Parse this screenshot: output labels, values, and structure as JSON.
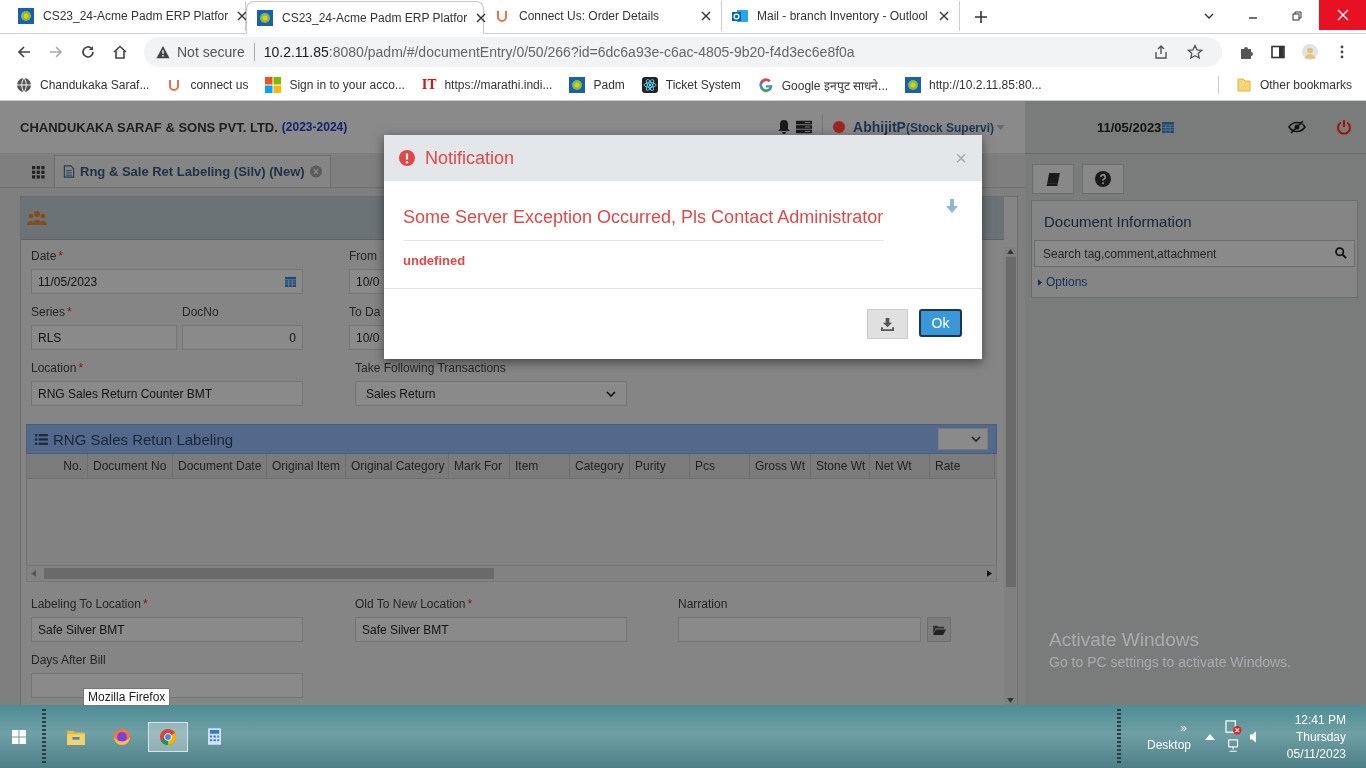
{
  "browser": {
    "tabs": [
      {
        "title": "CS23_24-Acme Padm ERP Platfor",
        "selected": false,
        "kind": "erp"
      },
      {
        "title": "CS23_24-Acme Padm ERP Platfor",
        "selected": true,
        "kind": "erp"
      },
      {
        "title": "Connect Us: Order Details",
        "selected": false,
        "kind": "connect"
      },
      {
        "title": "Mail - branch Inventory - Outlool",
        "selected": false,
        "kind": "mail"
      }
    ],
    "security": "Not secure",
    "url_host": "10.2.11.85",
    "url_path": ":8080/padm/#/documentEntry/0/50/266?id=6dc6a93e-c6ac-4805-9b20-f4d3ec6e8f0a",
    "bookmarks": [
      {
        "label": "Chandukaka Saraf...",
        "kind": "globe"
      },
      {
        "label": "connect us",
        "kind": "connect"
      },
      {
        "label": "Sign in to your acco...",
        "kind": "windows"
      },
      {
        "label": "https://marathi.indi...",
        "kind": "text",
        "logo": "IT"
      },
      {
        "label": "Padm",
        "kind": "erp"
      },
      {
        "label": "Ticket System",
        "kind": "react"
      },
      {
        "label": "Google इनपुट साधने...",
        "kind": "google"
      },
      {
        "label": "http://10.2.11.85:80...",
        "kind": "erp"
      }
    ],
    "other_bookmarks": "Other bookmarks"
  },
  "app": {
    "company": "CHANDUKAKA SARAF & SONS PVT. LTD.",
    "year": "(2023-2024)",
    "user": "AbhijitP",
    "role": "(Stock Supervi)",
    "date": "11/05/2023",
    "doc_tab": "Rng & Sale Ret Labeling (Silv) (New)"
  },
  "form": {
    "required_mark": "*",
    "date": {
      "label": "Date",
      "required": true,
      "value": "11/05/2023"
    },
    "from_date": {
      "label": "From",
      "value": "10/0"
    },
    "series": {
      "label": "Series",
      "required": true,
      "value": "RLS"
    },
    "doc_no": {
      "label": "DocNo",
      "required": false,
      "value": "0"
    },
    "to_date": {
      "label": "To Da",
      "value": "10/0"
    },
    "location": {
      "label": "Location",
      "required": true,
      "value": "RNG Sales Return Counter BMT"
    },
    "transactions": {
      "label": "Take Following Transactions",
      "required": false,
      "value": "Sales Return"
    },
    "labeling_to": {
      "label": "Labeling To Location",
      "required": true,
      "value": "Safe Silver BMT"
    },
    "old_to_new": {
      "label": "Old To New Location",
      "required": true,
      "value": "Safe Silver BMT"
    },
    "narration": {
      "label": "Narration",
      "required": false
    },
    "days_after_bill": {
      "label": "Days After Bill",
      "required": false
    }
  },
  "grid": {
    "title": "RNG Sales Retun Labeling",
    "columns": [
      "No.",
      "Document No",
      "Document Date",
      "Original Item",
      "Original Category",
      "Mark For",
      "Item",
      "Category",
      "Purity",
      "Pcs",
      "Gross Wt",
      "Stone Wt",
      "Net Wt",
      "Rate"
    ]
  },
  "side": {
    "title": "Document Information",
    "search_placeholder": "Search tag,comment,attachment",
    "options": "Options"
  },
  "modal": {
    "title": "Notification",
    "close": "×",
    "message": "Some Server Exception Occurred, Pls Contact Administrator",
    "detail": "undefined",
    "ok": "Ok"
  },
  "watermark": {
    "title": "Activate Windows",
    "subtitle": "Go to PC settings to activate Windows."
  },
  "tooltip": "Mozilla Firefox",
  "taskbar": {
    "apps": [
      {
        "kind": "explorer",
        "selected": false
      },
      {
        "kind": "firefox",
        "selected": false
      },
      {
        "kind": "chrome",
        "selected": true
      },
      {
        "kind": "calculator",
        "selected": false
      }
    ],
    "overflow": "»",
    "desktop": "Desktop",
    "time": "12:41 PM",
    "day": "Thursday",
    "date": "05/11/2023"
  }
}
